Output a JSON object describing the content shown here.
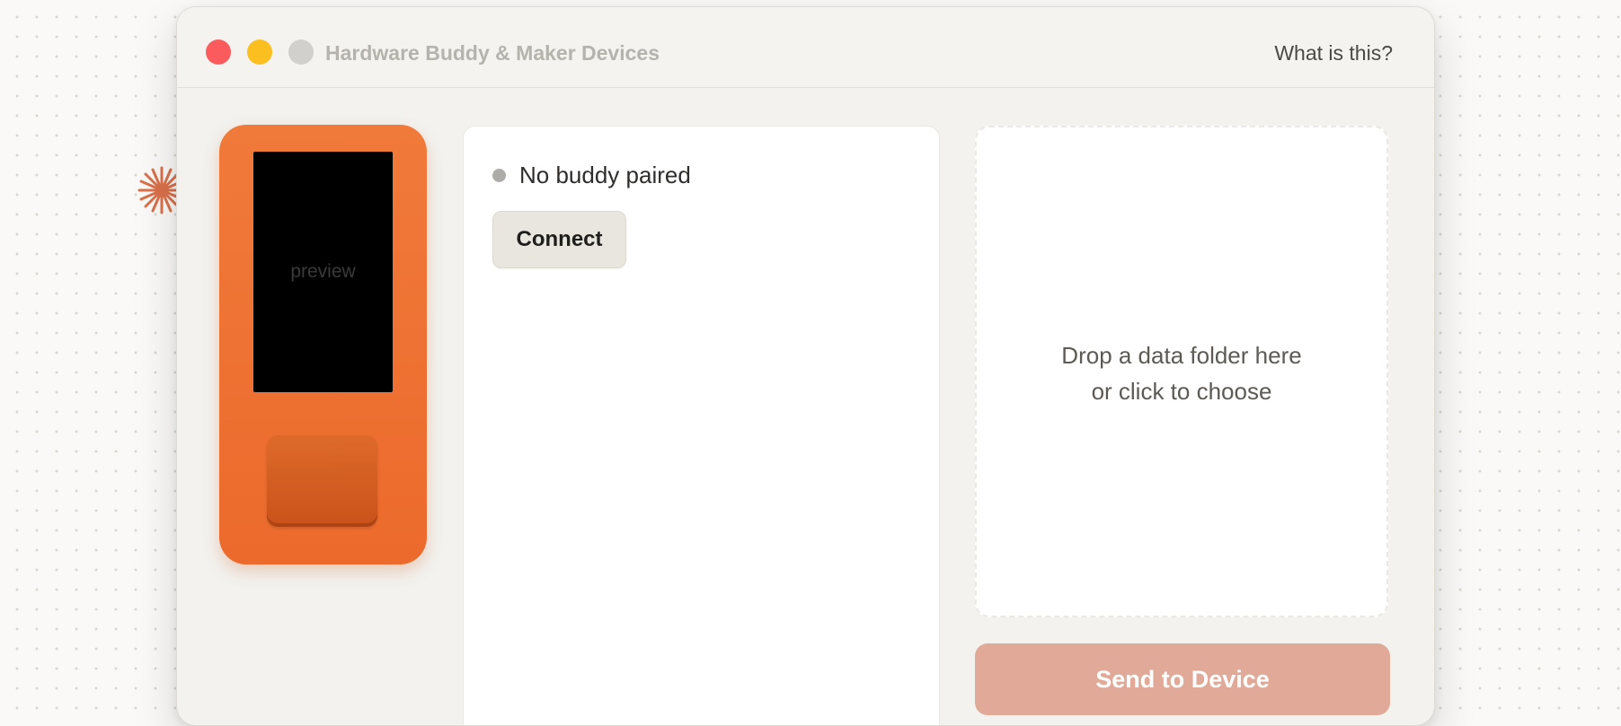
{
  "window": {
    "title": "Hardware Buddy & Maker Devices",
    "help_link": "What is this?"
  },
  "device_preview": {
    "screen_label": "preview"
  },
  "pairing": {
    "status_text": "No buddy paired",
    "connect_label": "Connect"
  },
  "dropzone": {
    "line1": "Drop a data folder here",
    "line2": "or click to choose"
  },
  "send_button": {
    "label": "Send to Device"
  },
  "colors": {
    "accent_orange": "#ec6a2c",
    "send_button": "#e1aa98",
    "close_light": "#fb5b5c",
    "minimize_light": "#fbbf20",
    "zoom_light": "#d2d0cc"
  },
  "icons": {
    "decoration": "asterisk-spark-icon",
    "status": "status-dot-icon"
  }
}
